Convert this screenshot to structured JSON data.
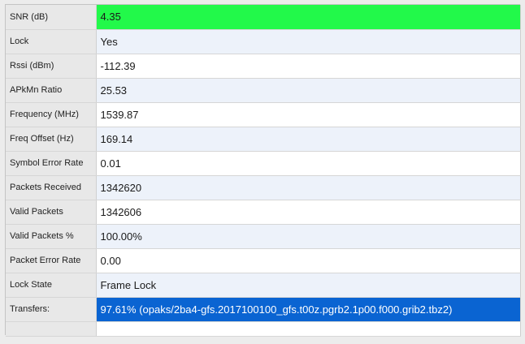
{
  "rows": [
    {
      "label": "SNR (dB)",
      "value": "4.35"
    },
    {
      "label": "Lock",
      "value": "Yes"
    },
    {
      "label": "Rssi (dBm)",
      "value": "-112.39"
    },
    {
      "label": "APkMn Ratio",
      "value": "25.53"
    },
    {
      "label": "Frequency (MHz)",
      "value": "1539.87"
    },
    {
      "label": "Freq Offset (Hz)",
      "value": "169.14"
    },
    {
      "label": "Symbol Error Rate",
      "value": "0.01"
    },
    {
      "label": "Packets Received",
      "value": "1342620"
    },
    {
      "label": "Valid Packets",
      "value": "1342606"
    },
    {
      "label": "Valid Packets %",
      "value": "100.00%"
    },
    {
      "label": "Packet Error Rate",
      "value": "0.00"
    },
    {
      "label": "Lock State",
      "value": "Frame Lock"
    },
    {
      "label": "Transfers:",
      "value": "97.61% (opaks/2ba4-gfs.2017100100_gfs.t00z.pgrb2.1p00.f000.grib2.tbz2)"
    },
    {
      "label": "",
      "value": ""
    }
  ],
  "colors": {
    "snr_highlight": "#22f94a",
    "selection": "#0a64d2",
    "selection_text": "#ffffff"
  }
}
